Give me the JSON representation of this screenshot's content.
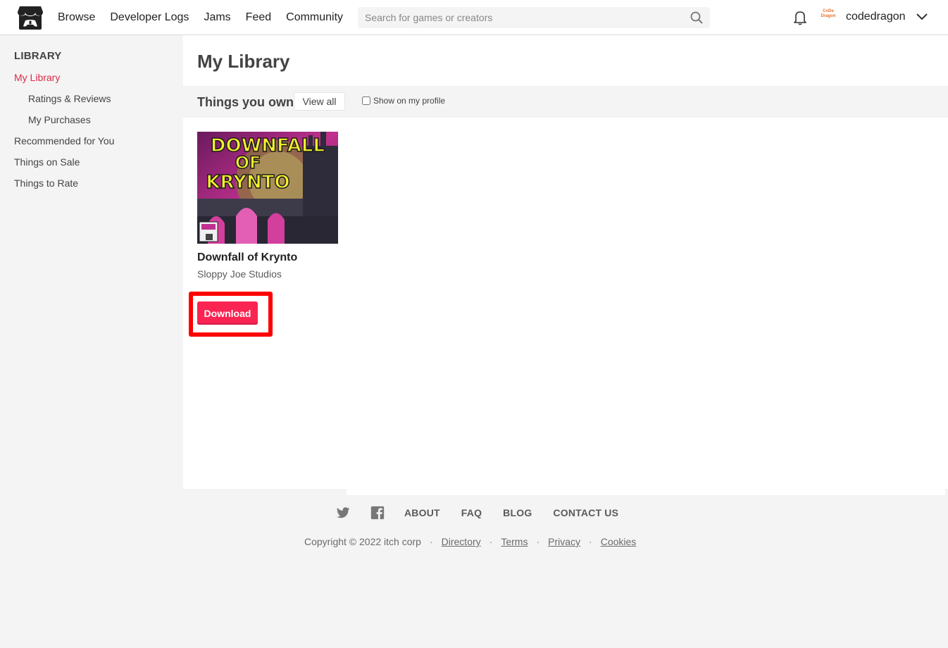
{
  "header": {
    "nav": [
      "Browse",
      "Developer Logs",
      "Jams",
      "Feed",
      "Community"
    ],
    "search_placeholder": "Search for games or creators",
    "username": "codedragon",
    "avatar_text": "CoDe Dragon"
  },
  "sidebar": {
    "heading": "LIBRARY",
    "items": [
      {
        "label": "My Library"
      },
      {
        "label": "Ratings & Reviews"
      },
      {
        "label": "My Purchases"
      },
      {
        "label": "Recommended for You"
      },
      {
        "label": "Things on Sale"
      },
      {
        "label": "Things to Rate"
      }
    ]
  },
  "main": {
    "title": "My Library",
    "section_title": "Things you own",
    "view_all": "View all",
    "show_on_profile": "Show on my profile",
    "game": {
      "title": "Downfall of Krynto",
      "author": "Sloppy Joe Studios",
      "cover_text_1": "DOWNFALL",
      "cover_text_2": "OF",
      "cover_text_3": "KRYNTO",
      "download_label": "Download"
    }
  },
  "footer": {
    "links": [
      "ABOUT",
      "FAQ",
      "BLOG",
      "CONTACT US"
    ],
    "copyright": "Copyright © 2022 itch corp",
    "legal": [
      "Directory",
      "Terms",
      "Privacy",
      "Cookies"
    ]
  },
  "colors": {
    "accent": "#da2c49",
    "download_button": "#fa2452",
    "highlight_box": "#ff0000"
  }
}
